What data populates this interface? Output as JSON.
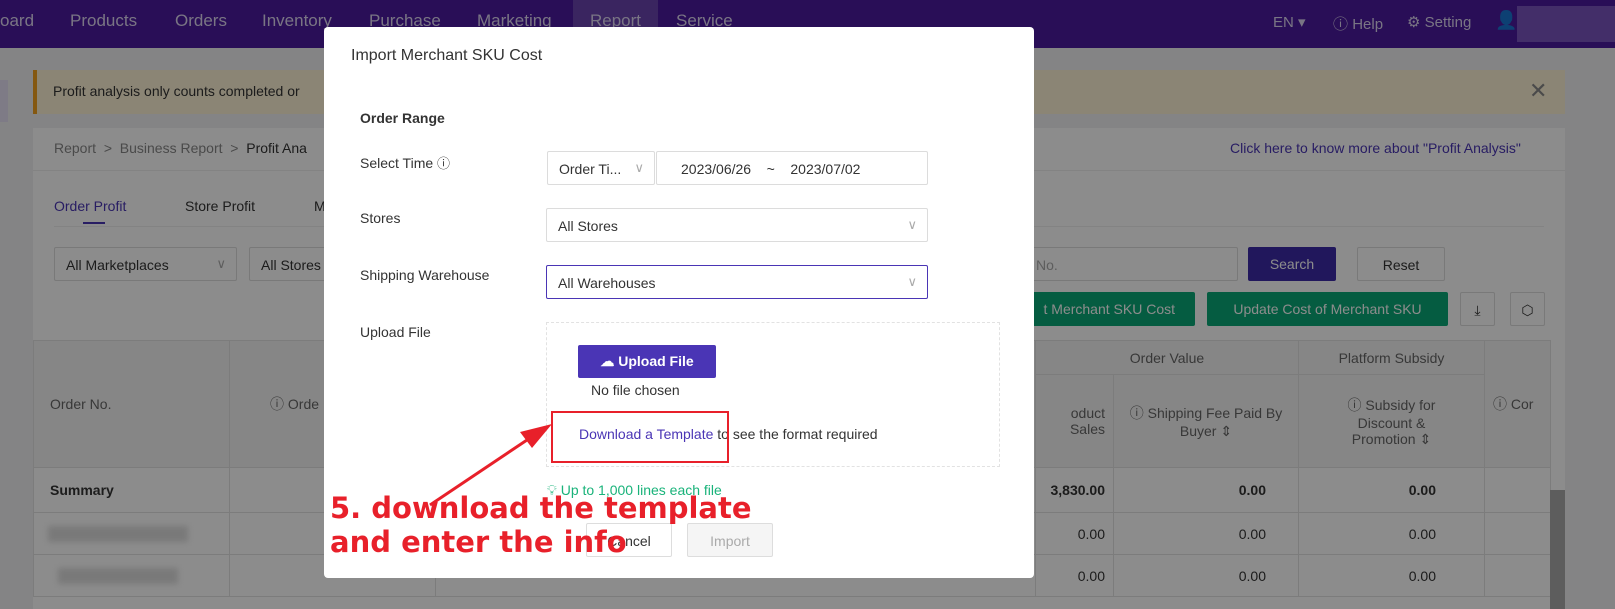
{
  "nav": {
    "items": [
      "oard",
      "Products",
      "Orders",
      "Inventory",
      "Purchase",
      "Marketing",
      "Report",
      "Service"
    ],
    "active": "Report",
    "lang": "EN",
    "help": "Help",
    "setting": "Setting"
  },
  "notice": {
    "text": "Profit analysis only counts completed or"
  },
  "breadcrumb": [
    "Report",
    ">",
    "Business Report",
    ">",
    "Profit Ana"
  ],
  "help_link": "Click here to know more about \"Profit Analysis\"",
  "tabs": [
    "Order Profit",
    "Store Profit",
    "M"
  ],
  "filters": {
    "marketplace": "All Marketplaces",
    "stores": "All Stores",
    "search_placeholder": "No.",
    "search": "Search",
    "reset": "Reset"
  },
  "actions": {
    "import": "t Merchant SKU Cost",
    "update": "Update Cost of Merchant SKU"
  },
  "table": {
    "headers": {
      "order_no": "Order No.",
      "order": "Orde",
      "order_value": "Order Value",
      "platform_subsidy": "Platform Subsidy",
      "product_sales": "oduct Sales",
      "shipping_fee": "Shipping Fee Paid By Buyer",
      "subsidy": "Subsidy for Discount & Promotion",
      "cor": "Cor"
    },
    "summary": {
      "label": "Summary",
      "sales": "3,830.00",
      "ship": "0.00",
      "subsidy": "0.00"
    },
    "rows": [
      {
        "sales": "0.00",
        "ship": "0.00",
        "subsidy": "0.00"
      },
      {
        "sales": "0.00",
        "ship": "0.00",
        "subsidy": "0.00"
      }
    ]
  },
  "modal": {
    "title": "Import Merchant SKU Cost",
    "section": "Order Range",
    "select_time": "Select Time",
    "time_type": "Order Ti...",
    "date_start": "2023/06/26",
    "date_sep": "~",
    "date_end": "2023/07/02",
    "stores_label": "Stores",
    "stores_value": "All Stores",
    "warehouse_label": "Shipping Warehouse",
    "warehouse_value": "All Warehouses",
    "upload_label": "Upload File",
    "upload_button": "Upload File",
    "no_file": "No file chosen",
    "download_link": "Download a Template",
    "download_suffix": " to see the format required",
    "tip": "Up to 1,000 lines each file",
    "cancel": "Cancel",
    "import": "Import"
  },
  "annotation": {
    "line1": "5. download the template",
    "line2": "and enter the info",
    "color": "#e8202a"
  },
  "colors": {
    "nav": "#4c1a9e",
    "primary": "#4a35b5",
    "green": "#0aa877",
    "tip": "#19b37a"
  }
}
